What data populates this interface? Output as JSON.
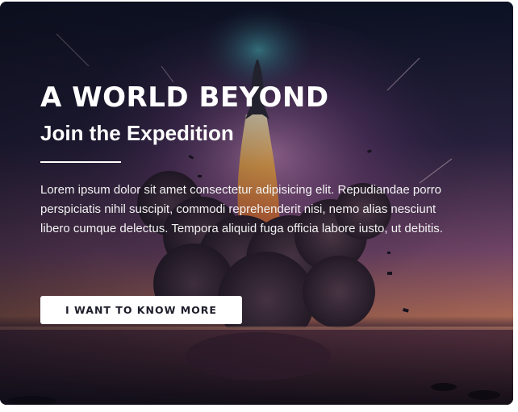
{
  "hero": {
    "headline": "A WORLD BEYOND",
    "subheadline": "Join the Expedition",
    "body": "Lorem ipsum dolor sit amet consectetur adipisicing elit. Repudiandae porro perspiciatis nihil suscipit, commodi reprehenderit nisi, nemo alias nesciunt libero cumque delectus. Tempora aliquid fuga officia labore iusto, ut debitis.",
    "cta_label": "I WANT TO KNOW MORE"
  },
  "colors": {
    "text": "#ffffff",
    "button_bg": "#ffffff",
    "button_text": "#1d1d2a",
    "sky_dark": "#0e1323",
    "sky_glow": "#8a4a8c",
    "flame": "#ff9a2e"
  }
}
